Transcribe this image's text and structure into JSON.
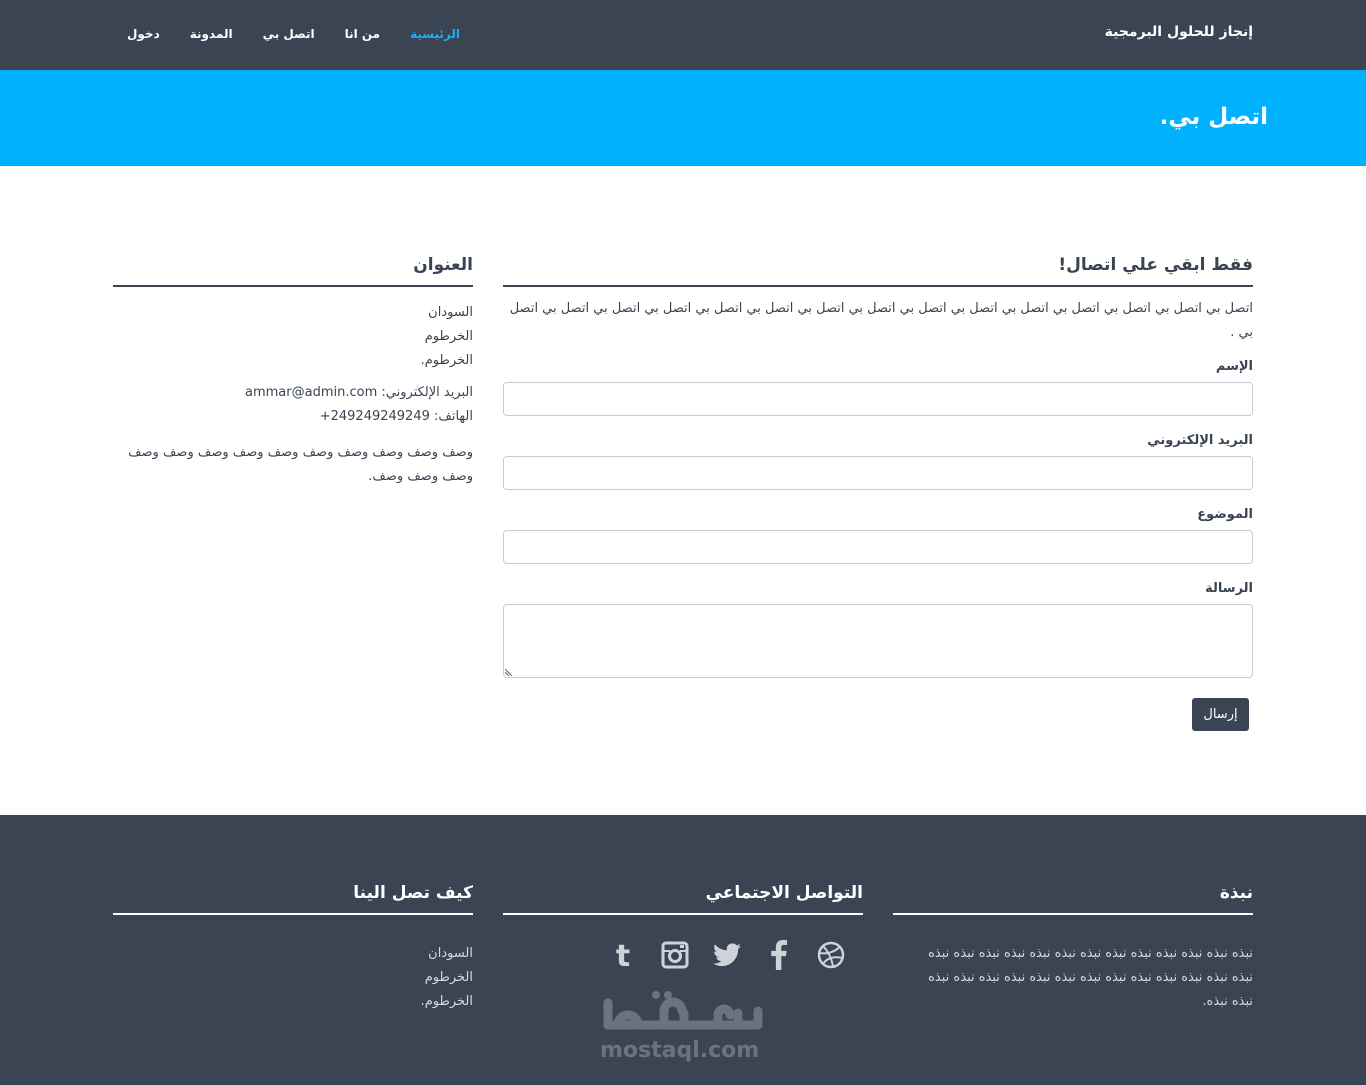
{
  "navbar": {
    "brand": "إنجاز للحلول البرمجية",
    "links": [
      {
        "label": "الرئيسية",
        "active": true
      },
      {
        "label": "من انا",
        "active": false
      },
      {
        "label": "اتصل بي",
        "active": false
      },
      {
        "label": "المدونة",
        "active": false
      },
      {
        "label": "دخول",
        "active": false
      }
    ]
  },
  "hero": {
    "title": "اتصل بي."
  },
  "form_section": {
    "title": "فقط ابقي علي اتصال!",
    "intro": "اتصل بي اتصل بي اتصل بي اتصل بي اتصل بي اتصل بي اتصل بي اتصل بي اتصل بي اتصل بي اتصل بي اتصل بي اتصل بي اتصل بي اتصل بي .",
    "name_label": "الإسم",
    "email_label": "البريد الإلكتروني",
    "subject_label": "الموضوع",
    "message_label": "الرسالة",
    "submit_label": "إرسال"
  },
  "address_section": {
    "title": "العنوان",
    "lines": [
      "السودان",
      "الخرطوم",
      "الخرطوم."
    ],
    "email_label": "البريد الإلكتروني:",
    "email_value": "ammar@admin.com",
    "phone_label": "الهاتف:",
    "phone_value": "+249249249249",
    "description": "وصف وصف وصف وصف وصف وصف وصف وصف وصف وصف وصف وصف وصف."
  },
  "footer": {
    "about": {
      "title": "نبذة",
      "text": "نبذه نبذه نبذه نبذه نبذه نبذه نبذه نبذه نبذه نبذه نبذه نبذه نبذه نبذه نبذه نبذه نبذه نبذه نبذه نبذه نبذه نبذه نبذه نبذه نبذه نبذه نبذه نبذه."
    },
    "social": {
      "title": "التواصل الاجتماعي",
      "icons": [
        "dribbble-icon",
        "facebook-icon",
        "twitter-icon",
        "instagram-icon",
        "tumblr-icon"
      ]
    },
    "reach": {
      "title": "كيف تصل الينا",
      "lines": [
        "السودان",
        "الخرطوم",
        "الخرطوم."
      ]
    },
    "watermark": "mostaql.com"
  },
  "colors": {
    "navbar": "#3a4452",
    "hero": "#00b2fd",
    "active_link": "#1ab0f5",
    "button": "#3a4452",
    "footer": "#3a4452"
  }
}
